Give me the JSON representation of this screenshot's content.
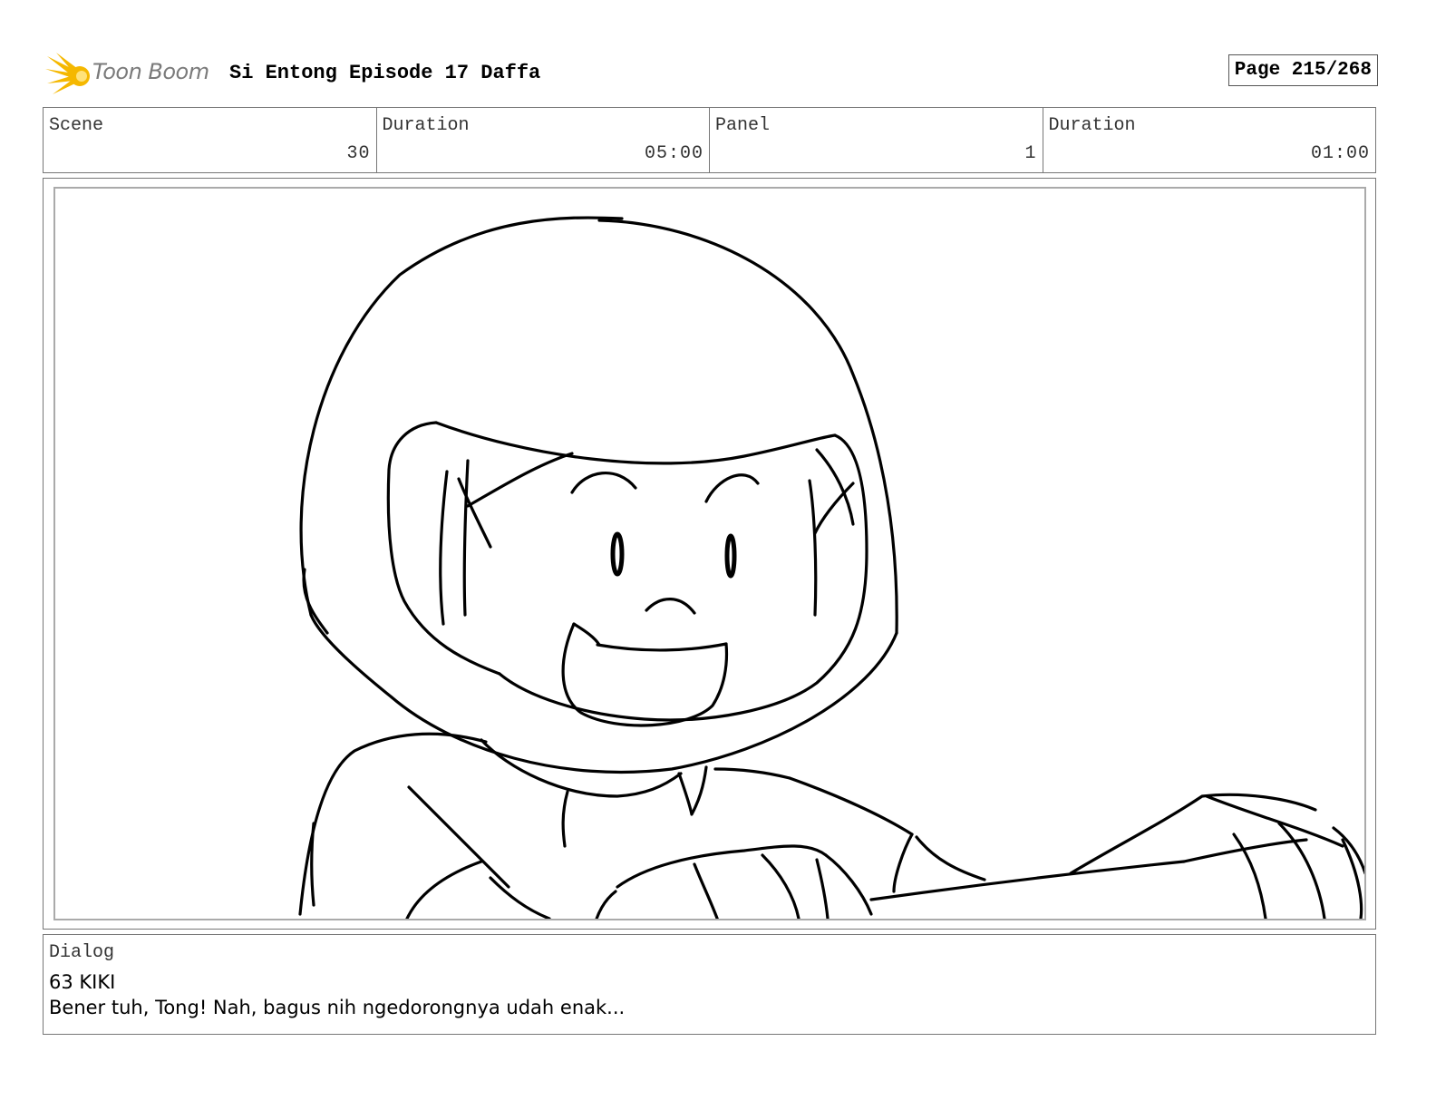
{
  "header": {
    "logo_text": "Toon Boom",
    "title": "Si Entong Episode 17 Daffa",
    "page": "Page 215/268"
  },
  "info": {
    "scene_label": "Scene",
    "scene_value": "30",
    "scene_duration_label": "Duration",
    "scene_duration_value": "05:00",
    "panel_label": "Panel",
    "panel_value": "1",
    "panel_duration_label": "Duration",
    "panel_duration_value": "01:00"
  },
  "dialog": {
    "label": "Dialog",
    "speaker": "63 KIKI",
    "text": "Bener tuh, Tong! Nah, bagus nih ngedorongnya udah enak..."
  },
  "colors": {
    "logo_yellow": "#f5b800",
    "logo_gray": "#7a7a7a",
    "border": "#777777",
    "ink": "#000000"
  }
}
